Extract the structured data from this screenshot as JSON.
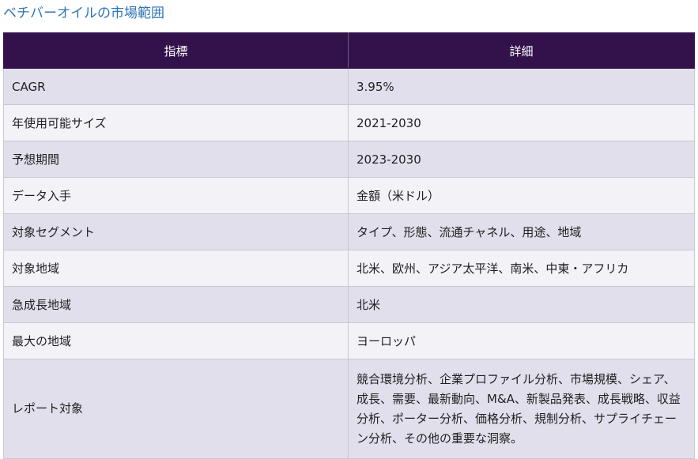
{
  "page": {
    "title": "ベチバーオイルの市場範囲"
  },
  "table": {
    "headers": [
      "指標",
      "詳細"
    ],
    "rows": [
      {
        "metric": "CAGR",
        "detail": "3.95%"
      },
      {
        "metric": "年使用可能サイズ",
        "detail": "2021-2030"
      },
      {
        "metric": "予想期間",
        "detail": "2023-2030"
      },
      {
        "metric": "データ入手",
        "detail": "金額（米ドル）"
      },
      {
        "metric": "対象セグメント",
        "detail": "タイプ、形態、流通チャネル、用途、地域"
      },
      {
        "metric": "対象地域",
        "detail": "北米、欧州、アジア太平洋、南米、中東・アフリカ"
      },
      {
        "metric": "急成長地域",
        "detail": "北米"
      },
      {
        "metric": "最大の地域",
        "detail": "ヨーロッパ"
      },
      {
        "metric": "レポート対象",
        "detail": "競合環境分析、企業プロファイル分析、市場規模、シェア、成長、需要、最新動向、M&A、新製品発表、成長戦略、収益分析、ポーター分析、価格分析、規制分析、サプライチェーン分析、その他の重要な洞察。"
      }
    ]
  },
  "colors": {
    "title": "#2e74b5",
    "header_bg": "#33124c",
    "row_odd": "#e2dfec",
    "row_even": "#f3f2f7"
  }
}
